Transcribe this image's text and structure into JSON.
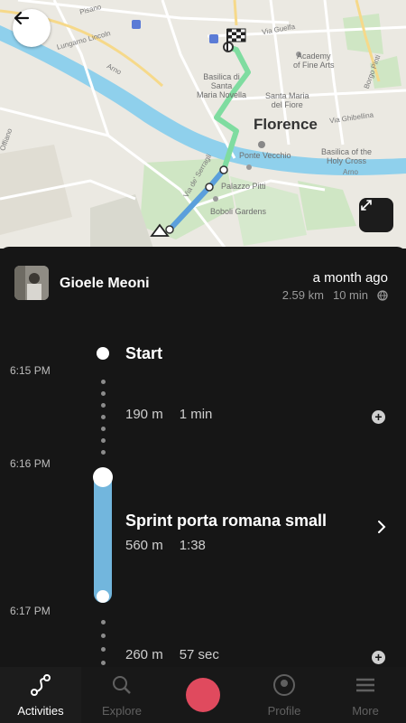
{
  "map": {
    "city": "Florence",
    "labels": {
      "basilica_maria_novella": "Basilica di\nSanta\nMaria Novella",
      "academy": "Academy\nof Fine Arts",
      "basilica_maria_fiore": "Basilica di\nSanta Maria\ndel Fiore",
      "santa_maria_fiore": "Santa Maria\ndel Fiore",
      "ponte_vecchio": "Ponte Vecchio",
      "palazzo_pitti": "Palazzo Pitti",
      "boboli": "Boboli Gardens",
      "basilica_croce": "Basilica of the\nHoly Cross",
      "arno_left": "Arno",
      "arno_right": "Arno",
      "via_guelfa": "Via Guelfa",
      "via_ghibellina": "Via Ghibellina",
      "borgo_pinti": "Borgo Pinti",
      "via_serragli": "Via de' Serragli",
      "lungarno": "Lungarno Lincoln",
      "pisano": "Pisano",
      "offiano": "Offiano"
    }
  },
  "header": {
    "user_name": "Gioele Meoni",
    "time_ago": "a month ago",
    "distance": "2.59 km",
    "duration": "10 min"
  },
  "timeline": {
    "start_label": "Start",
    "times": [
      "6:15 PM",
      "6:16 PM",
      "6:17 PM"
    ],
    "segments": [
      {
        "distance": "190 m",
        "duration": "1 min"
      },
      {
        "title": "Sprint porta romana small",
        "distance": "560 m",
        "duration": "1:38"
      },
      {
        "distance": "260 m",
        "duration": "57 sec"
      }
    ]
  },
  "nav": {
    "items": [
      {
        "label": "Activities"
      },
      {
        "label": "Explore"
      },
      {
        "label": "Profile"
      },
      {
        "label": "More"
      }
    ]
  },
  "colors": {
    "route_green": "#7fdca0",
    "route_blue": "#5b9fdc",
    "record": "#e04a5e",
    "segment_bar": "#72b6dd"
  }
}
